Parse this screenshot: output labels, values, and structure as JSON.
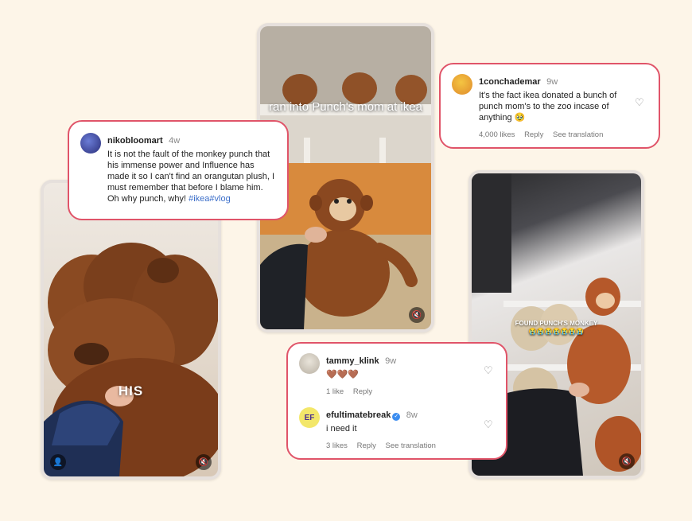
{
  "phones": {
    "left": {
      "caption": "HIS",
      "mute_icon": "🔇",
      "user_icon": "👤"
    },
    "center": {
      "caption": "ran into Punch's mom at ikea",
      "mute_icon": "🔇"
    },
    "right": {
      "caption": "FOUND PUNCH'S MONKEY",
      "caption_emojis": "😭😭😭😭😭😭😭",
      "mute_icon": "🔇"
    }
  },
  "comments": {
    "niko": {
      "username": "nikobloomart",
      "ago": "4w",
      "text": "It is not the fault of the monkey punch that his immense power and Influence has made it so I can't find an orangutan plush, I must remember that before I blame him. Oh why punch, why! ",
      "hashtags": "#ikea#vlog"
    },
    "concha": {
      "username": "1conchademar",
      "ago": "9w",
      "text": "It's the fact ikea donated a bunch of punch mom's to the zoo incase of anything 🥹",
      "likes": "4,000 likes",
      "reply": "Reply",
      "translate": "See translation",
      "heart": "♡"
    },
    "tammy": {
      "username": "tammy_klink",
      "ago": "9w",
      "text": "🤎🤎🤎",
      "likes": "1 like",
      "reply": "Reply",
      "heart": "♡"
    },
    "ef": {
      "username": "efultimatebreak",
      "ago": "8w",
      "avatar_text": "EF",
      "text": "i need it",
      "likes": "3 likes",
      "reply": "Reply",
      "translate": "See translation",
      "heart": "♡"
    }
  },
  "colors": {
    "accent": "#e05469",
    "background": "#fdf5e8",
    "hashtag": "#3b6ec9"
  }
}
